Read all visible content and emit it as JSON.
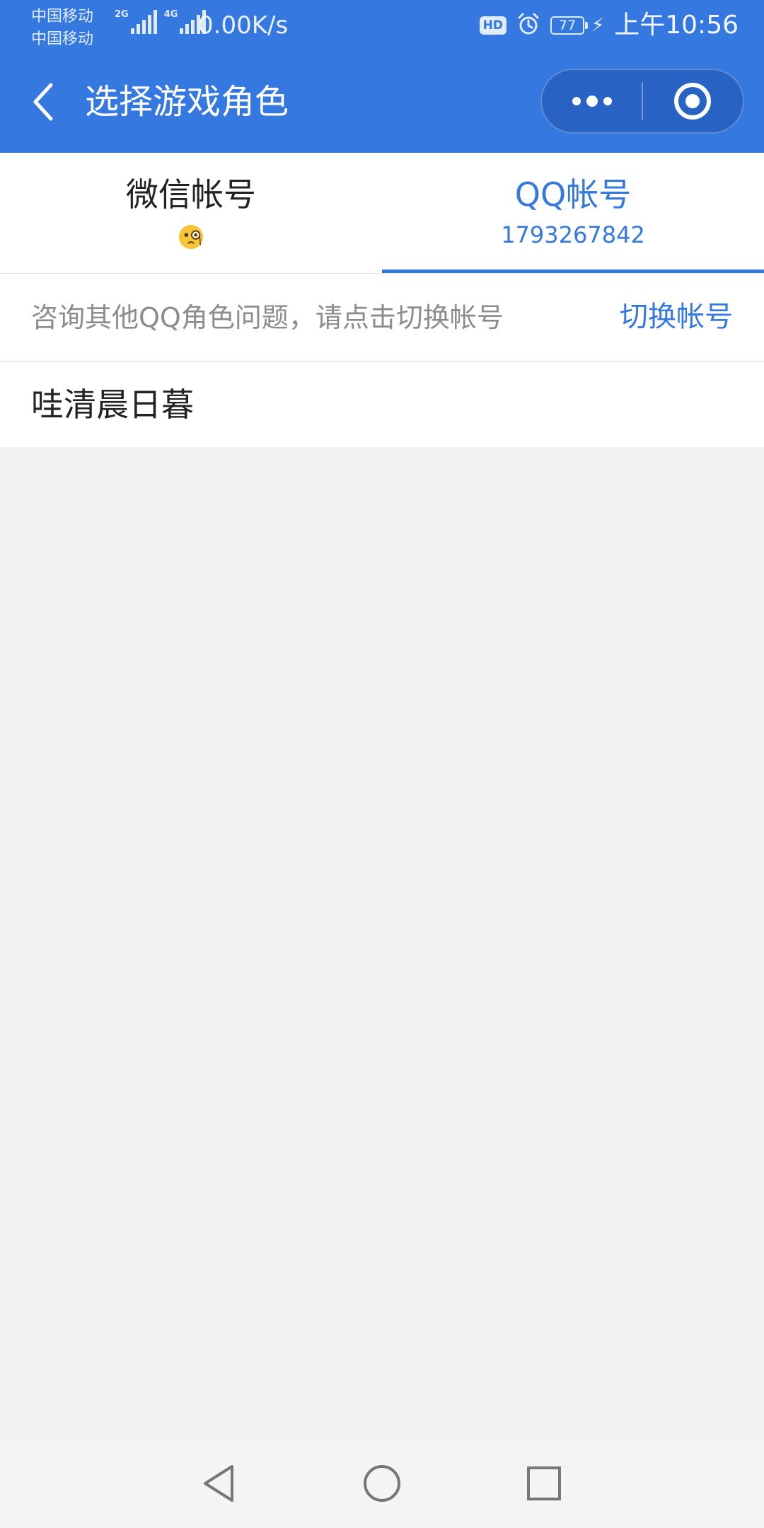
{
  "status_bar": {
    "carrier_1": "中国移动",
    "carrier_2": "中国移动",
    "network_1": "2G",
    "network_2": "4G",
    "speed": "0.00K/s",
    "hd": "HD",
    "battery": "77",
    "time": "上午10:56"
  },
  "navbar": {
    "title": "选择游戏角色"
  },
  "tabs": [
    {
      "label": "微信帐号",
      "sub": "",
      "icon": "monocle-face-emoji",
      "active": false
    },
    {
      "label": "QQ帐号",
      "sub": "1793267842",
      "active": true
    }
  ],
  "notice": {
    "text": "咨询其他QQ角色问题，请点击切换帐号",
    "link": "切换帐号"
  },
  "roles": [
    {
      "name": "哇清晨日暮"
    }
  ],
  "colors": {
    "primary": "#3478e0",
    "background": "#f2f2f2"
  }
}
